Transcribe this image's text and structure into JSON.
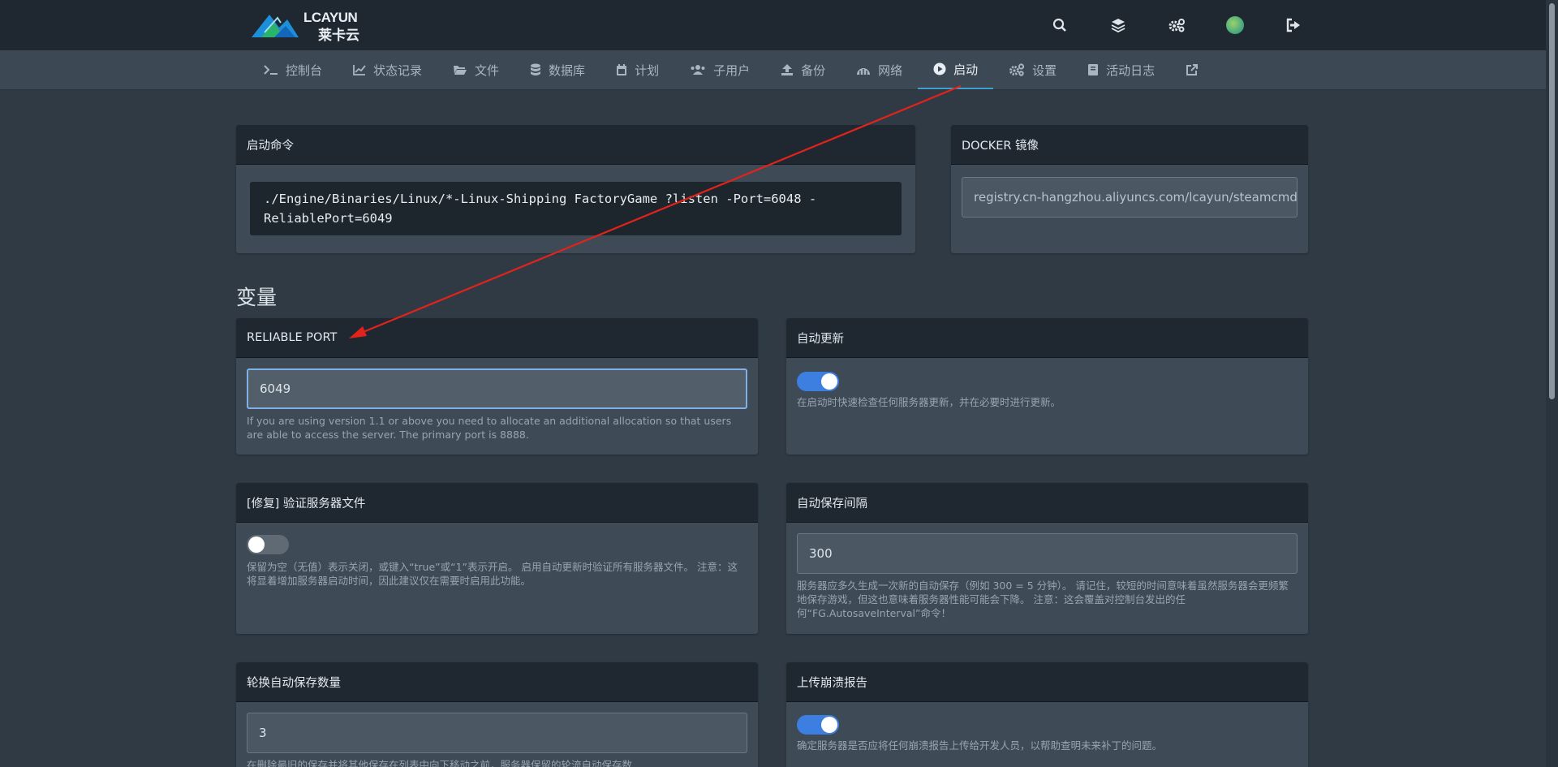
{
  "brand": {
    "logo_text": "LCAYUN",
    "logo_subtext": "莱卡云"
  },
  "top_icons": [
    "search-icon",
    "layers-icon",
    "cogs-icon",
    "avatar",
    "sign-out-icon"
  ],
  "nav": {
    "items": [
      {
        "label": "控制台",
        "icon": "terminal-icon"
      },
      {
        "label": "状态记录",
        "icon": "chart-icon"
      },
      {
        "label": "文件",
        "icon": "folder-icon"
      },
      {
        "label": "数据库",
        "icon": "database-icon"
      },
      {
        "label": "计划",
        "icon": "calendar-icon"
      },
      {
        "label": "子用户",
        "icon": "users-icon"
      },
      {
        "label": "备份",
        "icon": "upload-icon"
      },
      {
        "label": "网络",
        "icon": "network-icon"
      },
      {
        "label": "启动",
        "icon": "play-icon",
        "active": true
      },
      {
        "label": "设置",
        "icon": "cogs-icon"
      },
      {
        "label": "活动日志",
        "icon": "book-icon"
      },
      {
        "label": "",
        "icon": "external-link-icon"
      }
    ]
  },
  "startup": {
    "title": "启动命令",
    "command_line1": "./Engine/Binaries/Linux/*-Linux-Shipping FactoryGame ?listen -Port=6048 -",
    "command_line2": "ReliablePort=6049"
  },
  "docker": {
    "title": "DOCKER 镜像",
    "value": "registry.cn-hangzhou.aliyuncs.com/lcayun/steamcmd"
  },
  "variables_title": "变量",
  "vars": {
    "reliable_port": {
      "title": "RELIABLE PORT",
      "value": "6049",
      "help": "If you are using version 1.1 or above you need to allocate an additional allocation so that users are able to access the server. The primary port is 8888."
    },
    "auto_update": {
      "title": "自动更新",
      "enabled": true,
      "help": "在启动时快速检查任何服务器更新，并在必要时进行更新。"
    },
    "validate_files": {
      "title": "[修复] 验证服务器文件",
      "enabled": false,
      "help": "保留为空（无值）表示关闭，或键入“true”或“1”表示开启。 启用自动更新时验证所有服务器文件。 注意：这将显着增加服务器启动时间，因此建议仅在需要时启用此功能。"
    },
    "autosave_interval": {
      "title": "自动保存间隔",
      "value": "300",
      "help": "服务器应多久生成一次新的自动保存（例如 300 = 5 分钟）。 请记住，较短的时间意味着虽然服务器会更频繁地保存游戏，但这也意味着服务器性能可能会下降。 注意：这会覆盖对控制台发出的任何“FG.AutosaveInterval”命令！"
    },
    "autosave_count": {
      "title": "轮换自动保存数量",
      "value": "3",
      "help": "在删除最旧的保存并将其他保存在列表中向下移动之前，服务器保留的轮流自动保存数"
    },
    "crash_reports": {
      "title": "上传崩溃报告",
      "enabled": true,
      "help": "确定服务器是否应将任何崩溃报告上传给开发人员，以帮助查明未来补丁的问题。"
    }
  },
  "colors": {
    "accent": "#3d7fe0",
    "active_tab": "#3ea0cf",
    "annotation_arrow": "#e3231b"
  }
}
